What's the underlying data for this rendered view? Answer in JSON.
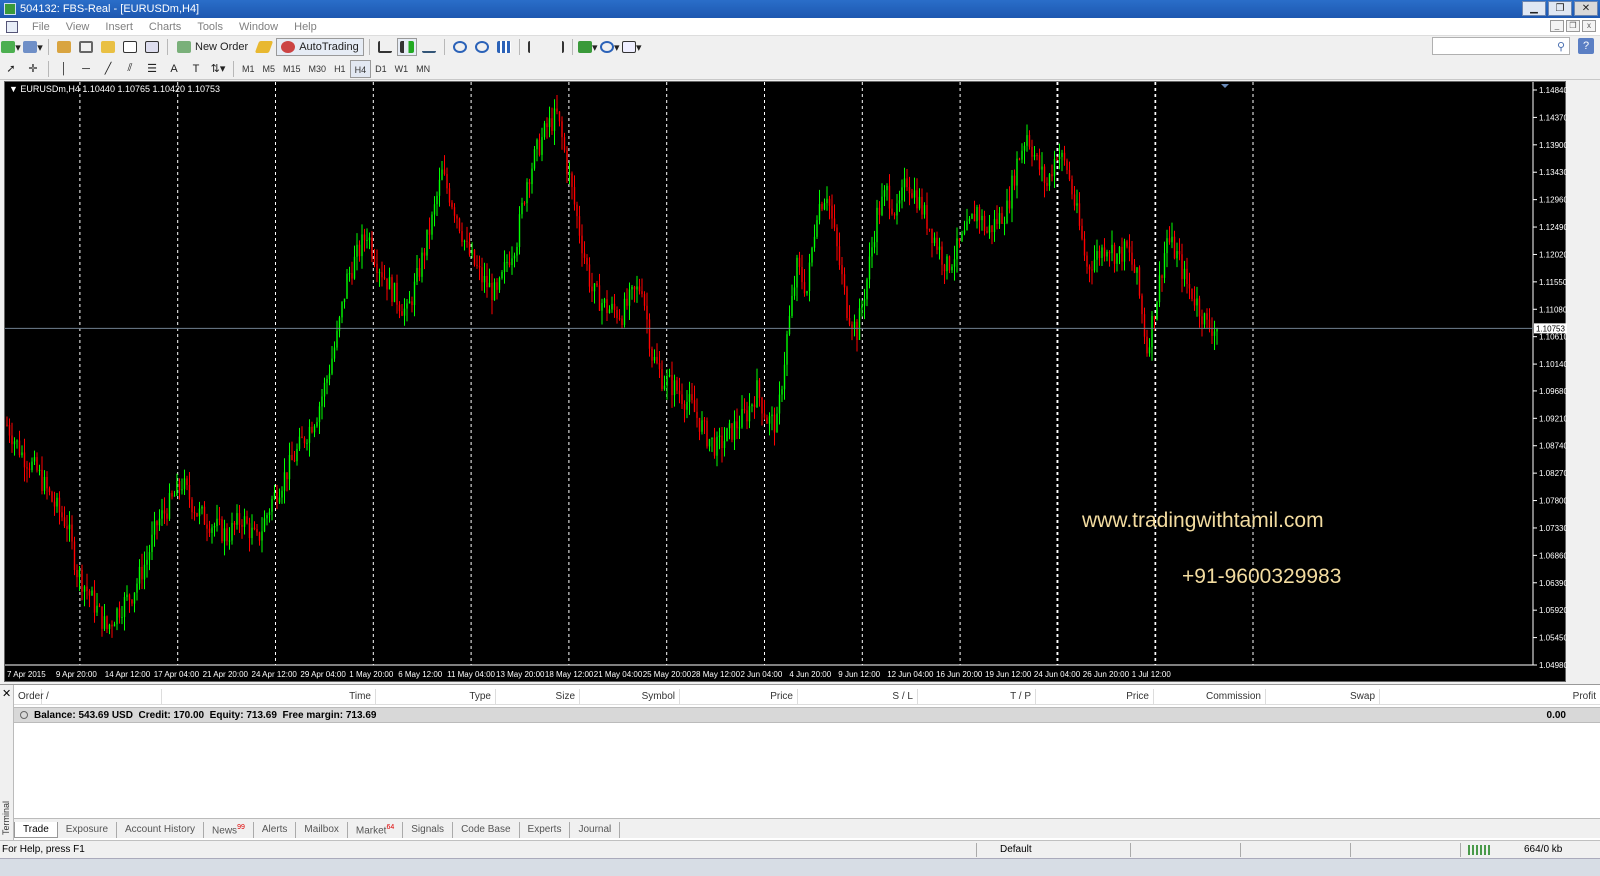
{
  "window": {
    "title": "504132: FBS-Real - [EURUSDm,H4]",
    "min": "▁",
    "max": "❐",
    "close": "✕"
  },
  "menu": [
    "File",
    "View",
    "Insert",
    "Charts",
    "Tools",
    "Window",
    "Help"
  ],
  "toolbar": {
    "new_order": "New Order",
    "autotrading": "AutoTrading"
  },
  "timeframes": [
    "M1",
    "M5",
    "M15",
    "M30",
    "H1",
    "H4",
    "D1",
    "W1",
    "MN"
  ],
  "active_timeframe": "H4",
  "chart": {
    "label": "▼ EURUSDm,H4  1.10440 1.10765 1.10420 1.10753",
    "current_price": "1.10753",
    "watermark_url": "www.tradingwithtamil.com",
    "watermark_phone": "+91-9600329983",
    "colors": {
      "bull": "#00ff00",
      "bear": "#ff0000",
      "grid": "#ffffff",
      "bid": "#708090"
    }
  },
  "chart_data": {
    "type": "candlestick",
    "symbol": "EURUSDm",
    "timeframe": "H4",
    "ylim": [
      1.0498,
      1.1484
    ],
    "y_ticks": [
      "1.14840",
      "1.14370",
      "1.13900",
      "1.13430",
      "1.12960",
      "1.12490",
      "1.12020",
      "1.11550",
      "1.11080",
      "1.10610",
      "1.10140",
      "1.09680",
      "1.09210",
      "1.08740",
      "1.08270",
      "1.07800",
      "1.07330",
      "1.06860",
      "1.06390",
      "1.05920",
      "1.05450",
      "1.04980"
    ],
    "x_ticks": [
      "7 Apr 2015",
      "9 Apr 20:00",
      "14 Apr 12:00",
      "17 Apr 04:00",
      "21 Apr 20:00",
      "24 Apr 12:00",
      "29 Apr 04:00",
      "1 May 20:00",
      "6 May 12:00",
      "11 May 04:00",
      "13 May 20:00",
      "18 May 12:00",
      "21 May 04:00",
      "25 May 20:00",
      "28 May 12:00",
      "2 Jun 04:00",
      "4 Jun 20:00",
      "9 Jun 12:00",
      "12 Jun 04:00",
      "16 Jun 20:00",
      "19 Jun 12:00",
      "24 Jun 04:00",
      "26 Jun 20:00",
      "1 Jul 12:00"
    ],
    "close_path": [
      [
        0,
        1.091
      ],
      [
        3,
        1.086
      ],
      [
        6,
        1.083
      ],
      [
        9,
        1.078
      ],
      [
        12,
        1.074
      ],
      [
        14,
        1.066
      ],
      [
        17,
        1.061
      ],
      [
        20,
        1.056
      ],
      [
        22,
        1.059
      ],
      [
        25,
        1.062
      ],
      [
        28,
        1.068
      ],
      [
        30,
        1.074
      ],
      [
        33,
        1.078
      ],
      [
        35,
        1.081
      ],
      [
        38,
        1.076
      ],
      [
        41,
        1.074
      ],
      [
        44,
        1.072
      ],
      [
        47,
        1.075
      ],
      [
        50,
        1.071
      ],
      [
        53,
        1.078
      ],
      [
        56,
        1.083
      ],
      [
        59,
        1.088
      ],
      [
        62,
        1.093
      ],
      [
        64,
        1.099
      ],
      [
        66,
        1.106
      ],
      [
        68,
        1.116
      ],
      [
        70,
        1.12
      ],
      [
        72,
        1.124
      ],
      [
        74,
        1.119
      ],
      [
        77,
        1.114
      ],
      [
        80,
        1.11
      ],
      [
        82,
        1.116
      ],
      [
        85,
        1.126
      ],
      [
        87,
        1.134
      ],
      [
        90,
        1.127
      ],
      [
        92,
        1.121
      ],
      [
        95,
        1.116
      ],
      [
        98,
        1.113
      ],
      [
        100,
        1.119
      ],
      [
        102,
        1.123
      ],
      [
        104,
        1.133
      ],
      [
        106,
        1.138
      ],
      [
        108,
        1.142
      ],
      [
        110,
        1.144
      ],
      [
        111,
        1.14
      ],
      [
        113,
        1.131
      ],
      [
        115,
        1.122
      ],
      [
        117,
        1.114
      ],
      [
        120,
        1.111
      ],
      [
        123,
        1.11
      ],
      [
        125,
        1.113
      ],
      [
        127,
        1.115
      ],
      [
        129,
        1.103
      ],
      [
        131,
        1.099
      ],
      [
        134,
        1.097
      ],
      [
        137,
        1.094
      ],
      [
        140,
        1.089
      ],
      [
        142,
        1.087
      ],
      [
        145,
        1.09
      ],
      [
        148,
        1.093
      ],
      [
        150,
        1.097
      ],
      [
        152,
        1.092
      ],
      [
        154,
        1.091
      ],
      [
        156,
        1.106
      ],
      [
        158,
        1.118
      ],
      [
        160,
        1.114
      ],
      [
        162,
        1.128
      ],
      [
        164,
        1.131
      ],
      [
        166,
        1.121
      ],
      [
        168,
        1.111
      ],
      [
        170,
        1.107
      ],
      [
        172,
        1.116
      ],
      [
        174,
        1.127
      ],
      [
        176,
        1.131
      ],
      [
        178,
        1.127
      ],
      [
        180,
        1.133
      ],
      [
        182,
        1.13
      ],
      [
        184,
        1.126
      ],
      [
        186,
        1.122
      ],
      [
        188,
        1.118
      ],
      [
        190,
        1.121
      ],
      [
        192,
        1.124
      ],
      [
        194,
        1.128
      ],
      [
        196,
        1.124
      ],
      [
        198,
        1.126
      ],
      [
        200,
        1.128
      ],
      [
        202,
        1.136
      ],
      [
        204,
        1.141
      ],
      [
        206,
        1.136
      ],
      [
        208,
        1.132
      ],
      [
        210,
        1.138
      ],
      [
        212,
        1.135
      ],
      [
        214,
        1.127
      ],
      [
        216,
        1.118
      ],
      [
        218,
        1.12
      ],
      [
        220,
        1.122
      ],
      [
        222,
        1.12
      ],
      [
        224,
        1.121
      ],
      [
        226,
        1.116
      ],
      [
        228,
        1.104
      ],
      [
        230,
        1.113
      ],
      [
        232,
        1.123
      ],
      [
        234,
        1.12
      ],
      [
        236,
        1.115
      ],
      [
        238,
        1.112
      ],
      [
        240,
        1.108
      ],
      [
        242,
        1.1075
      ]
    ]
  },
  "terminal": {
    "columns": [
      "Order",
      "/",
      "Time",
      "Type",
      "Size",
      "Symbol",
      "Price",
      "S / L",
      "T / P",
      "Price",
      "Commission",
      "Swap",
      "Profit"
    ],
    "balance": "Balance: 543.69 USD",
    "credit": "Credit: 170.00",
    "equity": "Equity: 713.69",
    "free_margin": "Free margin: 713.69",
    "profit": "0.00",
    "close": "✕",
    "vertical_label": "Terminal",
    "tabs": [
      {
        "label": "Trade",
        "badge": ""
      },
      {
        "label": "Exposure",
        "badge": ""
      },
      {
        "label": "Account History",
        "badge": ""
      },
      {
        "label": "News",
        "badge": "99"
      },
      {
        "label": "Alerts",
        "badge": ""
      },
      {
        "label": "Mailbox",
        "badge": ""
      },
      {
        "label": "Market",
        "badge": "64"
      },
      {
        "label": "Signals",
        "badge": ""
      },
      {
        "label": "Code Base",
        "badge": ""
      },
      {
        "label": "Experts",
        "badge": ""
      },
      {
        "label": "Journal",
        "badge": ""
      }
    ]
  },
  "status": {
    "help": "For Help, press F1",
    "profile": "Default",
    "traffic": "664/0 kb"
  }
}
